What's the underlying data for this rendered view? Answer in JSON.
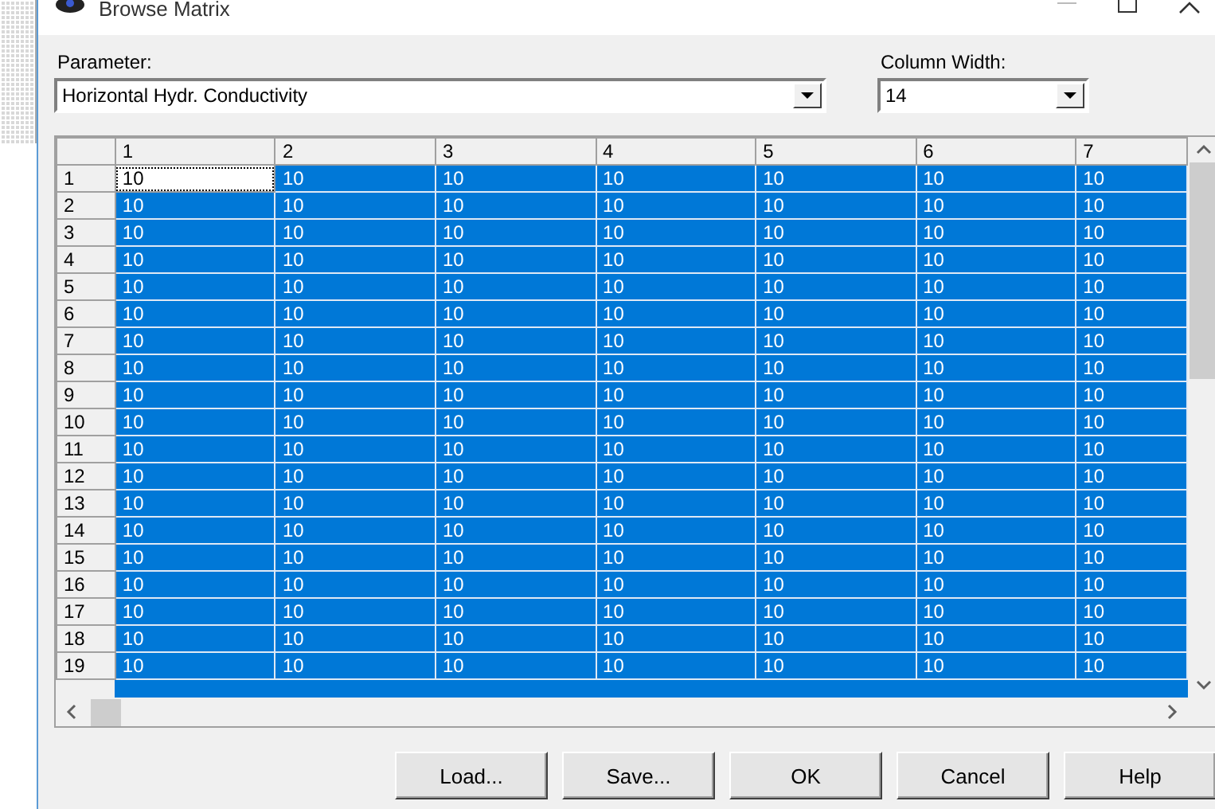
{
  "window": {
    "title": "Browse Matrix"
  },
  "parameter": {
    "label": "Parameter:",
    "value": "Horizontal Hydr. Conductivity"
  },
  "column_width": {
    "label": "Column Width:",
    "value": "14"
  },
  "table": {
    "columns": [
      "1",
      "2",
      "3",
      "4",
      "5",
      "6",
      "7"
    ],
    "rows": [
      {
        "header": "1",
        "cells": [
          {
            "text": "10",
            "selected": false
          },
          {
            "text": "10",
            "selected": true
          },
          {
            "text": "10",
            "selected": true
          },
          {
            "text": "10",
            "selected": true
          },
          {
            "text": "10",
            "selected": true
          },
          {
            "text": "10",
            "selected": true
          },
          {
            "text": "10",
            "selected": true
          }
        ]
      },
      {
        "header": "2",
        "cells": [
          {
            "text": "10",
            "selected": true
          },
          {
            "text": "10",
            "selected": true
          },
          {
            "text": "10",
            "selected": true
          },
          {
            "text": "10",
            "selected": true
          },
          {
            "text": "10",
            "selected": true
          },
          {
            "text": "10",
            "selected": true
          },
          {
            "text": "10",
            "selected": true
          }
        ]
      },
      {
        "header": "3",
        "cells": [
          {
            "text": "10",
            "selected": true
          },
          {
            "text": "10",
            "selected": true
          },
          {
            "text": "10",
            "selected": true
          },
          {
            "text": "10",
            "selected": true
          },
          {
            "text": "10",
            "selected": true
          },
          {
            "text": "10",
            "selected": true
          },
          {
            "text": "10",
            "selected": true
          }
        ]
      },
      {
        "header": "4",
        "cells": [
          {
            "text": "10",
            "selected": true
          },
          {
            "text": "10",
            "selected": true
          },
          {
            "text": "10",
            "selected": true
          },
          {
            "text": "10",
            "selected": true
          },
          {
            "text": "10",
            "selected": true
          },
          {
            "text": "10",
            "selected": true
          },
          {
            "text": "10",
            "selected": true
          }
        ]
      },
      {
        "header": "5",
        "cells": [
          {
            "text": "10",
            "selected": true
          },
          {
            "text": "10",
            "selected": true
          },
          {
            "text": "10",
            "selected": true
          },
          {
            "text": "10",
            "selected": true
          },
          {
            "text": "10",
            "selected": true
          },
          {
            "text": "10",
            "selected": true
          },
          {
            "text": "10",
            "selected": true
          }
        ]
      },
      {
        "header": "6",
        "cells": [
          {
            "text": "10",
            "selected": true
          },
          {
            "text": "10",
            "selected": true
          },
          {
            "text": "10",
            "selected": true
          },
          {
            "text": "10",
            "selected": true
          },
          {
            "text": "10",
            "selected": true
          },
          {
            "text": "10",
            "selected": true
          },
          {
            "text": "10",
            "selected": true
          }
        ]
      },
      {
        "header": "7",
        "cells": [
          {
            "text": "10",
            "selected": true
          },
          {
            "text": "10",
            "selected": true
          },
          {
            "text": "10",
            "selected": true
          },
          {
            "text": "10",
            "selected": true
          },
          {
            "text": "10",
            "selected": true
          },
          {
            "text": "10",
            "selected": true
          },
          {
            "text": "10",
            "selected": true
          }
        ]
      },
      {
        "header": "8",
        "cells": [
          {
            "text": "10",
            "selected": true
          },
          {
            "text": "10",
            "selected": true
          },
          {
            "text": "10",
            "selected": true
          },
          {
            "text": "10",
            "selected": true
          },
          {
            "text": "10",
            "selected": true
          },
          {
            "text": "10",
            "selected": true
          },
          {
            "text": "10",
            "selected": true
          }
        ]
      },
      {
        "header": "9",
        "cells": [
          {
            "text": "10",
            "selected": true
          },
          {
            "text": "10",
            "selected": true
          },
          {
            "text": "10",
            "selected": true
          },
          {
            "text": "10",
            "selected": true
          },
          {
            "text": "10",
            "selected": true
          },
          {
            "text": "10",
            "selected": true
          },
          {
            "text": "10",
            "selected": true
          }
        ]
      },
      {
        "header": "10",
        "cells": [
          {
            "text": "10",
            "selected": true
          },
          {
            "text": "10",
            "selected": true
          },
          {
            "text": "10",
            "selected": true
          },
          {
            "text": "10",
            "selected": true
          },
          {
            "text": "10",
            "selected": true
          },
          {
            "text": "10",
            "selected": true
          },
          {
            "text": "10",
            "selected": true
          }
        ]
      },
      {
        "header": "11",
        "cells": [
          {
            "text": "10",
            "selected": true
          },
          {
            "text": "10",
            "selected": true
          },
          {
            "text": "10",
            "selected": true
          },
          {
            "text": "10",
            "selected": true
          },
          {
            "text": "10",
            "selected": true
          },
          {
            "text": "10",
            "selected": true
          },
          {
            "text": "10",
            "selected": true
          }
        ]
      },
      {
        "header": "12",
        "cells": [
          {
            "text": "10",
            "selected": true
          },
          {
            "text": "10",
            "selected": true
          },
          {
            "text": "10",
            "selected": true
          },
          {
            "text": "10",
            "selected": true
          },
          {
            "text": "10",
            "selected": true
          },
          {
            "text": "10",
            "selected": true
          },
          {
            "text": "10",
            "selected": true
          }
        ]
      },
      {
        "header": "13",
        "cells": [
          {
            "text": "10",
            "selected": true
          },
          {
            "text": "10",
            "selected": true
          },
          {
            "text": "10",
            "selected": true
          },
          {
            "text": "10",
            "selected": true
          },
          {
            "text": "10",
            "selected": true
          },
          {
            "text": "10",
            "selected": true
          },
          {
            "text": "10",
            "selected": true
          }
        ]
      },
      {
        "header": "14",
        "cells": [
          {
            "text": "10",
            "selected": true
          },
          {
            "text": "10",
            "selected": true
          },
          {
            "text": "10",
            "selected": true
          },
          {
            "text": "10",
            "selected": true
          },
          {
            "text": "10",
            "selected": true
          },
          {
            "text": "10",
            "selected": true
          },
          {
            "text": "10",
            "selected": true
          }
        ]
      },
      {
        "header": "15",
        "cells": [
          {
            "text": "10",
            "selected": true
          },
          {
            "text": "10",
            "selected": true
          },
          {
            "text": "10",
            "selected": true
          },
          {
            "text": "10",
            "selected": true
          },
          {
            "text": "10",
            "selected": true
          },
          {
            "text": "10",
            "selected": true
          },
          {
            "text": "10",
            "selected": true
          }
        ]
      },
      {
        "header": "16",
        "cells": [
          {
            "text": "10",
            "selected": true
          },
          {
            "text": "10",
            "selected": true
          },
          {
            "text": "10",
            "selected": true
          },
          {
            "text": "10",
            "selected": true
          },
          {
            "text": "10",
            "selected": true
          },
          {
            "text": "10",
            "selected": true
          },
          {
            "text": "10",
            "selected": true
          }
        ]
      },
      {
        "header": "17",
        "cells": [
          {
            "text": "10",
            "selected": true
          },
          {
            "text": "10",
            "selected": true
          },
          {
            "text": "10",
            "selected": true
          },
          {
            "text": "10",
            "selected": true
          },
          {
            "text": "10",
            "selected": true
          },
          {
            "text": "10",
            "selected": true
          },
          {
            "text": "10",
            "selected": true
          }
        ]
      },
      {
        "header": "18",
        "cells": [
          {
            "text": "10",
            "selected": true
          },
          {
            "text": "10",
            "selected": true
          },
          {
            "text": "10",
            "selected": true
          },
          {
            "text": "10",
            "selected": true
          },
          {
            "text": "10",
            "selected": true
          },
          {
            "text": "10",
            "selected": true
          },
          {
            "text": "10",
            "selected": true
          }
        ]
      },
      {
        "header": "19",
        "cells": [
          {
            "text": "10",
            "selected": true
          },
          {
            "text": "10",
            "selected": true
          },
          {
            "text": "10",
            "selected": true
          },
          {
            "text": "10",
            "selected": true
          },
          {
            "text": "10",
            "selected": true
          },
          {
            "text": "10",
            "selected": true
          },
          {
            "text": "10",
            "selected": true
          }
        ]
      }
    ]
  },
  "buttons": [
    "Load...",
    "Save...",
    "OK",
    "Cancel",
    "Help"
  ]
}
